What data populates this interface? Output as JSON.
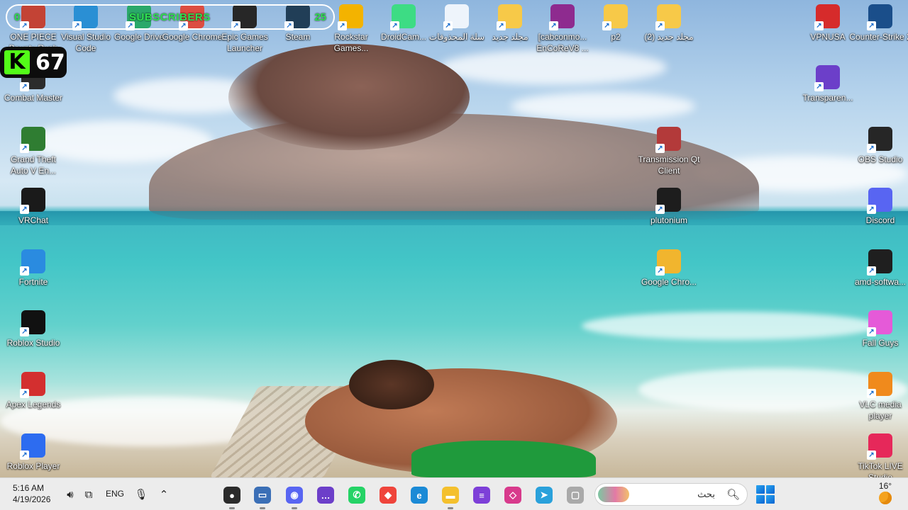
{
  "overlay": {
    "subscribers": {
      "left_count": "0",
      "label": "SUBSCRIBERS",
      "right_count": "25"
    },
    "kick": {
      "logo": "K",
      "count": "67"
    }
  },
  "desktop_icons": [
    {
      "label": "ONE PIECE Bounty Rush",
      "icon": "game-icon",
      "color": "#c0392b"
    },
    {
      "label": "Visual Studio Code",
      "icon": "vscode-icon",
      "color": "#1f8ad2"
    },
    {
      "label": "Google Drive",
      "icon": "google-drive-icon",
      "color": "#1fa463"
    },
    {
      "label": "Google Chrome",
      "icon": "chrome-icon",
      "color": "#db4437"
    },
    {
      "label": "Epic Games Launcher",
      "icon": "epic-games-icon",
      "color": "#1c1c1c"
    },
    {
      "label": "Steam",
      "icon": "steam-icon",
      "color": "#16344f"
    },
    {
      "label": "Rockstar Games...",
      "icon": "rockstar-icon",
      "color": "#f3b300"
    },
    {
      "label": "DroidCam...",
      "icon": "android-icon",
      "color": "#3ddc84"
    },
    {
      "label": "سلة المحذوفات",
      "icon": "recycle-bin-icon",
      "color": "#eef4fb"
    },
    {
      "label": "مجلد جديد",
      "icon": "folder-icon",
      "color": "#f7c948"
    },
    {
      "label": "[cabconmo... EnCoReV8 ...",
      "icon": "winrar-icon",
      "color": "#8e2b8f"
    },
    {
      "label": "p2",
      "icon": "folder-icon",
      "color": "#f7c948"
    },
    {
      "label": "(2) مجلد جديد",
      "icon": "folder-icon",
      "color": "#f7c948"
    },
    {
      "label": "VPNUSA",
      "icon": "vpn-icon",
      "color": "#d62b2b"
    },
    {
      "label": "Counter-Strike 2",
      "icon": "counter-strike-icon",
      "color": "#1a4e8a"
    },
    {
      "label": "Combat Master",
      "icon": "combat-master-icon",
      "color": "#2c2c2c"
    },
    {
      "label": "Transparen...",
      "icon": "chat-bubble-icon",
      "color": "#6c3fc9"
    },
    {
      "label": "Grand Theft Auto V En...",
      "icon": "gta-v-icon",
      "color": "#2f7d32"
    },
    {
      "label": "Transmission Qt Client",
      "icon": "transmission-icon",
      "color": "#b33a3a"
    },
    {
      "label": "OBS Studio",
      "icon": "obs-icon",
      "color": "#262626"
    },
    {
      "label": "VRChat",
      "icon": "vrchat-icon",
      "color": "#1a1a1a"
    },
    {
      "label": "plutonium",
      "icon": "atom-icon",
      "color": "#1d1d1d"
    },
    {
      "label": "Discord",
      "icon": "discord-icon",
      "color": "#5865f2"
    },
    {
      "label": "Fortnite",
      "icon": "fortnite-icon",
      "color": "#2a8be0"
    },
    {
      "label": "Google Chro...",
      "icon": "chrome-canary-icon",
      "color": "#f1b52e"
    },
    {
      "label": "amd-softwa...",
      "icon": "amd-icon",
      "color": "#1f1f1f"
    },
    {
      "label": "Roblox Studio",
      "icon": "roblox-studio-icon",
      "color": "#111111"
    },
    {
      "label": "Fall Guys",
      "icon": "fall-guys-icon",
      "color": "#e55ad8"
    },
    {
      "label": "Apex Legends",
      "icon": "apex-icon",
      "color": "#d32f2f"
    },
    {
      "label": "VLC media player",
      "icon": "vlc-icon",
      "color": "#f08a1c"
    },
    {
      "label": "Roblox Player",
      "icon": "roblox-icon",
      "color": "#2d6cf0"
    },
    {
      "label": "TikTok LIVE Studio",
      "icon": "tiktok-icon",
      "color": "#e6285a"
    }
  ],
  "taskbar": {
    "time": "5:16 AM",
    "date": "4/19/2026",
    "language": "ENG",
    "search_placeholder": "بحث",
    "weather_temp": "16°",
    "apps": [
      {
        "name": "obs",
        "icon": "obs-icon",
        "color": "#2b2b2b",
        "glyph": "●"
      },
      {
        "name": "terminal",
        "icon": "terminal-icon",
        "color": "#3b6fb6",
        "glyph": "▭"
      },
      {
        "name": "discord",
        "icon": "discord-icon",
        "color": "#5865f2",
        "glyph": "◉"
      },
      {
        "name": "chat",
        "icon": "chat-bubble-icon",
        "color": "#6c3fc9",
        "glyph": "…"
      },
      {
        "name": "whatsapp",
        "icon": "whatsapp-icon",
        "color": "#25d366",
        "glyph": "✆"
      },
      {
        "name": "anydesk",
        "icon": "anydesk-icon",
        "color": "#ef443b",
        "glyph": "◆"
      },
      {
        "name": "edge",
        "icon": "edge-icon",
        "color": "#1b8ad6",
        "glyph": "e"
      },
      {
        "name": "file-explorer",
        "icon": "folder-icon",
        "color": "#f4c02d",
        "glyph": "▬"
      },
      {
        "name": "clipchamp",
        "icon": "clipchamp-icon",
        "color": "#7d3fd8",
        "glyph": "≡"
      },
      {
        "name": "onenote",
        "icon": "note-icon",
        "color": "#d83a8c",
        "glyph": "◇"
      },
      {
        "name": "telegram",
        "icon": "telegram-icon",
        "color": "#2aa1db",
        "glyph": "➤"
      },
      {
        "name": "window",
        "icon": "window-icon",
        "color": "#a9a9a9",
        "glyph": "▢"
      }
    ]
  }
}
